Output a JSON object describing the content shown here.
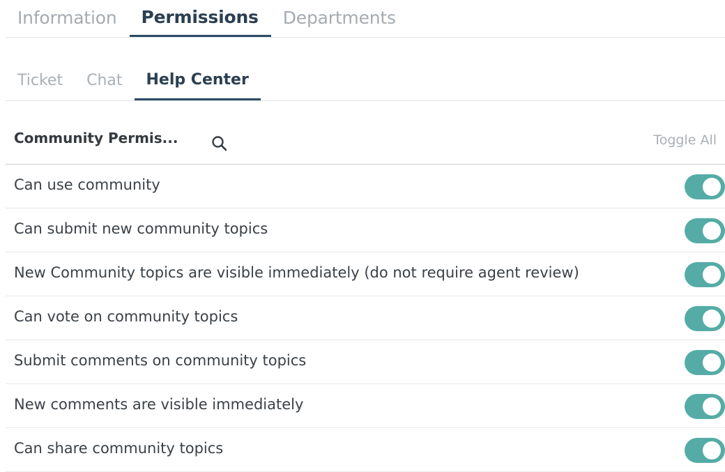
{
  "main_tabs": [
    {
      "label": "Information",
      "active": false
    },
    {
      "label": "Permissions",
      "active": true
    },
    {
      "label": "Departments",
      "active": false
    }
  ],
  "sub_tabs": [
    {
      "label": "Ticket",
      "active": false
    },
    {
      "label": "Chat",
      "active": false
    },
    {
      "label": "Help Center",
      "active": true
    }
  ],
  "permissions_header": {
    "title": "Community Permis...",
    "search_icon": "search-icon",
    "toggle_all_label": "Toggle All"
  },
  "permissions": [
    {
      "label": "Can use community",
      "enabled": true
    },
    {
      "label": "Can submit new community topics",
      "enabled": true
    },
    {
      "label": "New Community topics are visible immediately (do not require agent review)",
      "enabled": true
    },
    {
      "label": "Can vote on community topics",
      "enabled": true
    },
    {
      "label": "Submit comments on community topics",
      "enabled": true
    },
    {
      "label": "New comments are visible immediately",
      "enabled": true
    },
    {
      "label": "Can share community topics",
      "enabled": true
    }
  ],
  "colors": {
    "toggle_on": "#55aca6",
    "active_tab_text": "#2b3f52",
    "inactive_tab_text": "#a4abb1",
    "active_tab_underline": "#2b4a66"
  }
}
